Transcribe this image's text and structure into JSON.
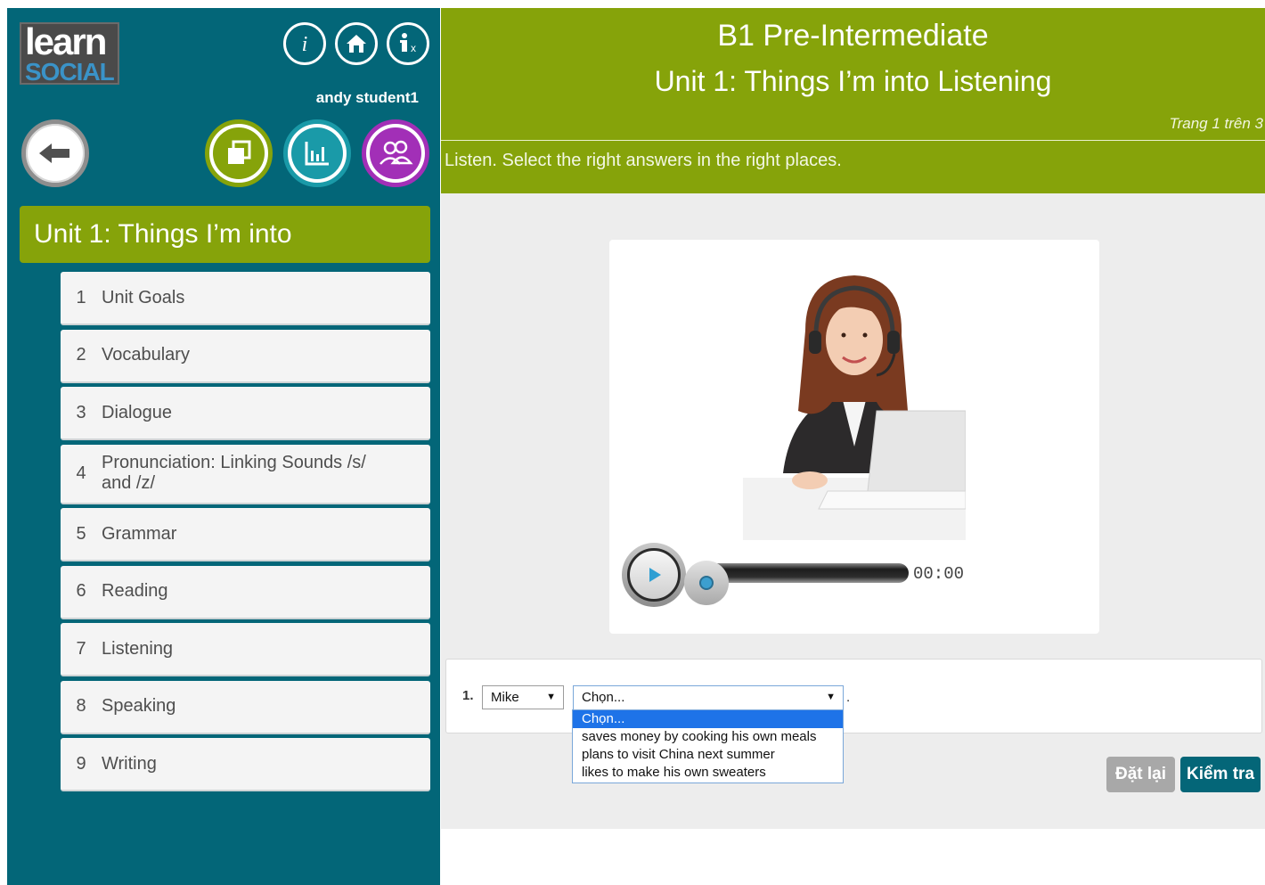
{
  "app": {
    "logo_line1": "learn",
    "logo_line2": "SOCIAL",
    "username": "andy student1"
  },
  "sidebar": {
    "unit_title": "Unit 1: Things I’m into",
    "items": [
      {
        "num": "1",
        "label": "Unit Goals"
      },
      {
        "num": "2",
        "label": "Vocabulary"
      },
      {
        "num": "3",
        "label": "Dialogue"
      },
      {
        "num": "4",
        "label": "Pronunciation: Linking Sounds /s/ and /z/"
      },
      {
        "num": "5",
        "label": "Grammar"
      },
      {
        "num": "6",
        "label": "Reading"
      },
      {
        "num": "7",
        "label": "Listening"
      },
      {
        "num": "8",
        "label": "Speaking"
      },
      {
        "num": "9",
        "label": "Writing"
      }
    ]
  },
  "header": {
    "course": "B1 Pre-Intermediate",
    "unit": "Unit 1: Things I’m into Listening",
    "page_indicator": "Trang 1 trên 3",
    "instruction": "Listen. Select the right answers in the right places."
  },
  "player": {
    "time": "00:00",
    "progress": 0
  },
  "question": {
    "number": "1.",
    "name_value": "Mike",
    "answer_value": "Chọn...",
    "trailing": ".",
    "options": [
      "Chọn...",
      "saves money by cooking his own meals",
      "plans to visit China next summer",
      "likes to make his own sweaters"
    ],
    "selected_option": 0
  },
  "buttons": {
    "reset": "Đặt lại",
    "check": "Kiểm tra"
  },
  "colors": {
    "sidebar": "#036678",
    "accent_green": "#86a30a",
    "btn_check": "#046678",
    "btn_reset": "#a8a8a8",
    "icon_yellow": "#86a30a",
    "icon_teal": "#1a9aa8",
    "icon_purple": "#a22fb7"
  }
}
